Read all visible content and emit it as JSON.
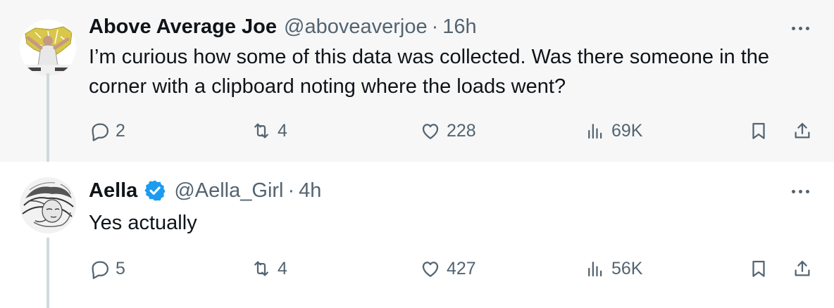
{
  "tweets": [
    {
      "author_name": "Above Average Joe",
      "handle": "@aboveaverjoe",
      "separator": "·",
      "time": "16h",
      "text": "I’m curious how some of this data was collected. Was there someone in the corner with a clipboard noting where the loads went?",
      "verified": false,
      "stats": {
        "replies": "2",
        "retweets": "4",
        "likes": "228",
        "views": "69K"
      }
    },
    {
      "author_name": "Aella",
      "handle": "@Aella_Girl",
      "separator": "·",
      "time": "4h",
      "text": "Yes actually",
      "verified": true,
      "stats": {
        "replies": "5",
        "retweets": "4",
        "likes": "427",
        "views": "56K"
      }
    }
  ],
  "icons": {
    "reply": "reply-icon",
    "retweet": "retweet-icon",
    "like": "heart-icon",
    "views": "views-icon",
    "bookmark": "bookmark-icon",
    "share": "share-icon",
    "more": "more-dots-icon",
    "verified": "verified-badge-icon"
  },
  "colors": {
    "text_primary": "#0f1419",
    "text_secondary": "#536471",
    "verified_blue": "#1d9bf0",
    "highlight_bg": "#f7f7f7",
    "thread_line": "#cfd9de"
  }
}
